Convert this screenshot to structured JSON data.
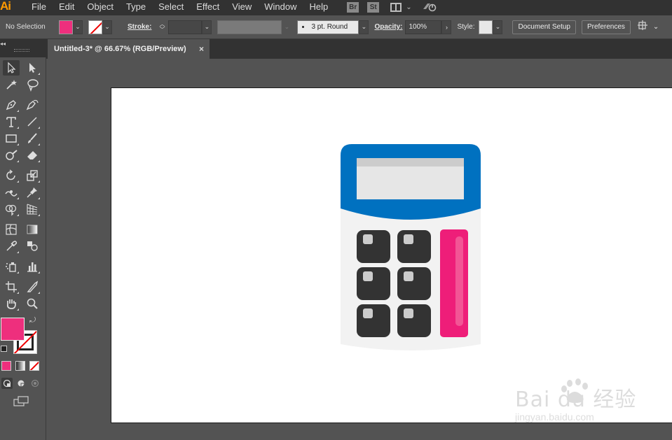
{
  "app": {
    "logo": "Ai",
    "menu": [
      "File",
      "Edit",
      "Object",
      "Type",
      "Select",
      "Effect",
      "View",
      "Window",
      "Help"
    ],
    "badges": [
      "Br",
      "St"
    ]
  },
  "control_bar": {
    "selection_label": "No Selection",
    "fill_color": "#ee2f7d",
    "stroke_label": "Stroke:",
    "stroke_profile": "3 pt. Round",
    "opacity_label": "Opacity:",
    "opacity_value": "100%",
    "style_label": "Style:",
    "document_setup": "Document Setup",
    "preferences": "Preferences"
  },
  "document": {
    "tab_title": "Untitled-3* @ 66.67% (RGB/Preview)",
    "close_glyph": "×"
  },
  "toolbar": {
    "fill_color": "#ee2f7d"
  },
  "artwork": {
    "calculator": {
      "top_color": "#0071c0",
      "display_color": "#e6e6e6",
      "body_color": "#f2f2f2",
      "key_color": "#333333",
      "key_highlight": "#cccccc",
      "accent_color": "#ee1e79",
      "key_count": 6
    }
  },
  "watermark": {
    "brand": "Bai du 经验",
    "url": "jingyan.baidu.com"
  }
}
